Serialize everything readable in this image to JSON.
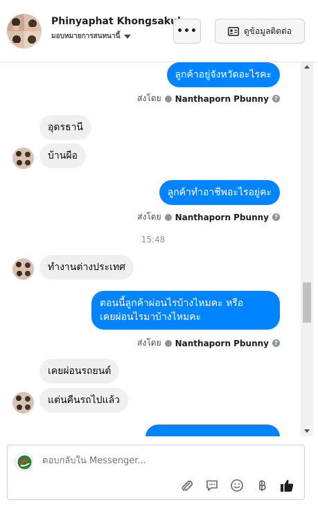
{
  "header": {
    "name": "Phinyaphat Khongsakul",
    "assign_label": "มอบหมายการสนทนานี้",
    "more_label": "•••",
    "contact_label": "ดูข้อมูลติดต่อ"
  },
  "messages": [
    {
      "dir": "out",
      "text": "ลูกค้าอยู่จังหวัดอะไรคะ"
    },
    {
      "dir": "sent-by",
      "prefix": "ส่งโดย",
      "name": "Nanthaporn Pbunny"
    },
    {
      "dir": "in",
      "text": "อุดรธานี"
    },
    {
      "dir": "in",
      "text": "บ้านผือ"
    },
    {
      "dir": "out",
      "text": "ลูกค้าทำอาชีพอะไรอยู่คะ"
    },
    {
      "dir": "sent-by",
      "prefix": "ส่งโดย",
      "name": "Nanthaporn Pbunny"
    },
    {
      "dir": "time",
      "text": "15:48"
    },
    {
      "dir": "in",
      "text": "ทำงานต่างประเทศ"
    },
    {
      "dir": "out",
      "lines": [
        "ตอนนี้ลูกค้าผ่อนไรบ้างไหมคะ หรือ",
        "เคยผ่อนไรมาบ้างไหมคะ"
      ]
    },
    {
      "dir": "sent-by",
      "prefix": "ส่งโดย",
      "name": "Nanthaporn Pbunny"
    },
    {
      "dir": "in",
      "text": "เคยผ่อนรถยนต์"
    },
    {
      "dir": "in",
      "text": "แต่นคืนรถไปแล้ว"
    }
  ],
  "composer": {
    "placeholder": "ตอบกลับใน Messenger...",
    "icons": [
      "paperclip-icon",
      "comment-icon",
      "smiley-icon",
      "baht-icon",
      "thumbs-up-icon"
    ]
  },
  "colors": {
    "accent": "#0084ff",
    "incoming_bubble": "#f0f0f0",
    "muted": "#8d949e"
  }
}
